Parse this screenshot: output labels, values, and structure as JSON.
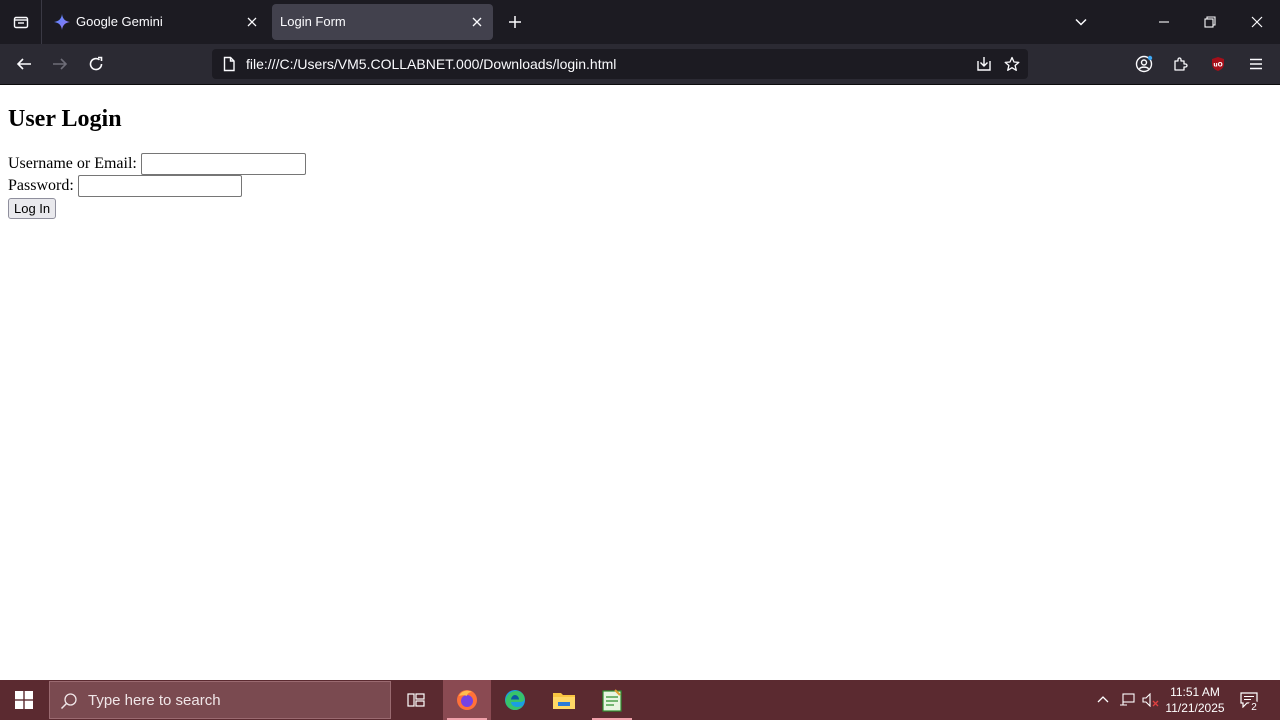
{
  "browser": {
    "tabs": [
      {
        "title": "Google Gemini",
        "active": false,
        "icon": "gemini-sparkle-icon"
      },
      {
        "title": "Login Form",
        "active": true,
        "icon": "none"
      }
    ],
    "url": "file:///C:/Users/VM5.COLLABNET.000/Downloads/login.html",
    "colors": {
      "tabbar": "#1c1b22",
      "navbar": "#2b2a33",
      "active_tab": "#42414d"
    }
  },
  "page": {
    "heading": "User Login",
    "username_label": "Username or Email:",
    "username_value": "",
    "password_label": "Password:",
    "password_value": "",
    "login_button": "Log In"
  },
  "taskbar": {
    "search_placeholder": "Type here to search",
    "time": "11:51 AM",
    "date": "11/21/2025",
    "notification_count": "2",
    "colors": {
      "background": "#5b2a30",
      "search": "#7a4a50"
    },
    "apps": [
      "task-view-icon",
      "firefox-icon",
      "edge-icon",
      "file-explorer-icon",
      "notepad-icon"
    ]
  }
}
